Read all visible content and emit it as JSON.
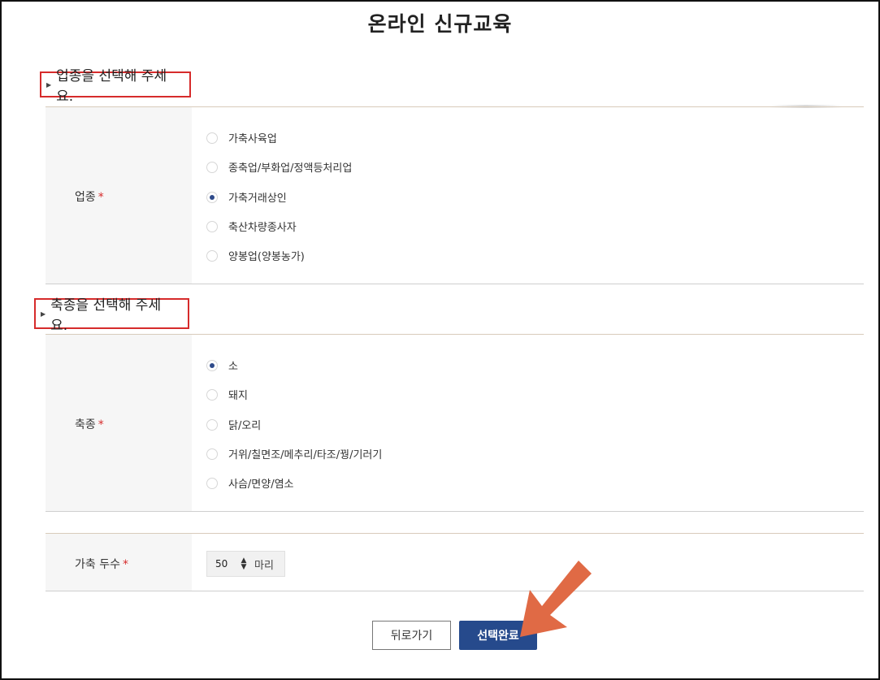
{
  "page": {
    "title": "온라인 신규교육"
  },
  "section_industry": {
    "heading": "업종을 선택해 주세요.",
    "label": "업종",
    "required_mark": "*",
    "options": [
      {
        "label": "가축사육업",
        "selected": false
      },
      {
        "label": "종축업/부화업/정액등처리업",
        "selected": false
      },
      {
        "label": "가축거래상인",
        "selected": true
      },
      {
        "label": "축산차량종사자",
        "selected": false
      },
      {
        "label": "양봉업(양봉농가)",
        "selected": false
      }
    ]
  },
  "section_species": {
    "heading": "축종을 선택해 주세요.",
    "label": "축종",
    "required_mark": "*",
    "options": [
      {
        "label": "소",
        "selected": true
      },
      {
        "label": "돼지",
        "selected": false
      },
      {
        "label": "닭/오리",
        "selected": false
      },
      {
        "label": "거위/칠면조/메추리/타조/꿩/기러기",
        "selected": false
      },
      {
        "label": "사슴/면양/염소",
        "selected": false
      }
    ]
  },
  "head_count": {
    "label": "가축 두수",
    "required_mark": "*",
    "value": "50",
    "unit": "마리"
  },
  "buttons": {
    "back": "뒤로가기",
    "done": "선택완료"
  },
  "colors": {
    "primary": "#264a8c",
    "highlight_border": "#d62b2b",
    "arrow": "#e06a45"
  }
}
